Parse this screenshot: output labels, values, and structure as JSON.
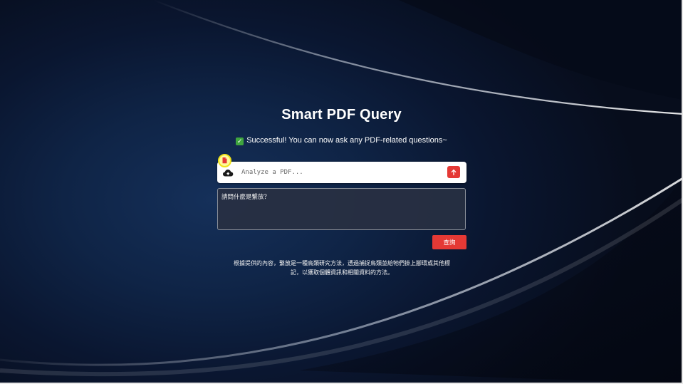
{
  "app": {
    "title": "Smart PDF Query",
    "status_icon": "check-mark-icon",
    "status_message": "Successful! You can now ask any PDF-related questions~"
  },
  "upload": {
    "placeholder": "Analyze a PDF...",
    "value": "",
    "upload_icon": "cloud-upload-icon",
    "file_badge_icon": "pdf-file-icon",
    "send_icon": "arrow-up-icon"
  },
  "question": {
    "value": "請問什麼是繫放？"
  },
  "query_button": {
    "label": "查詢"
  },
  "answer": {
    "text": "根據提供的內容，繫放是一種鳥類研究方法，透過捕捉鳥類並給牠們掛上腳環或其他標記，以獲取個體資訊和相關資料的方法。"
  },
  "colors": {
    "accent": "#e53935",
    "background": "#0b1326",
    "status_check": "#3fa53f",
    "badge": "#fffb9a"
  }
}
